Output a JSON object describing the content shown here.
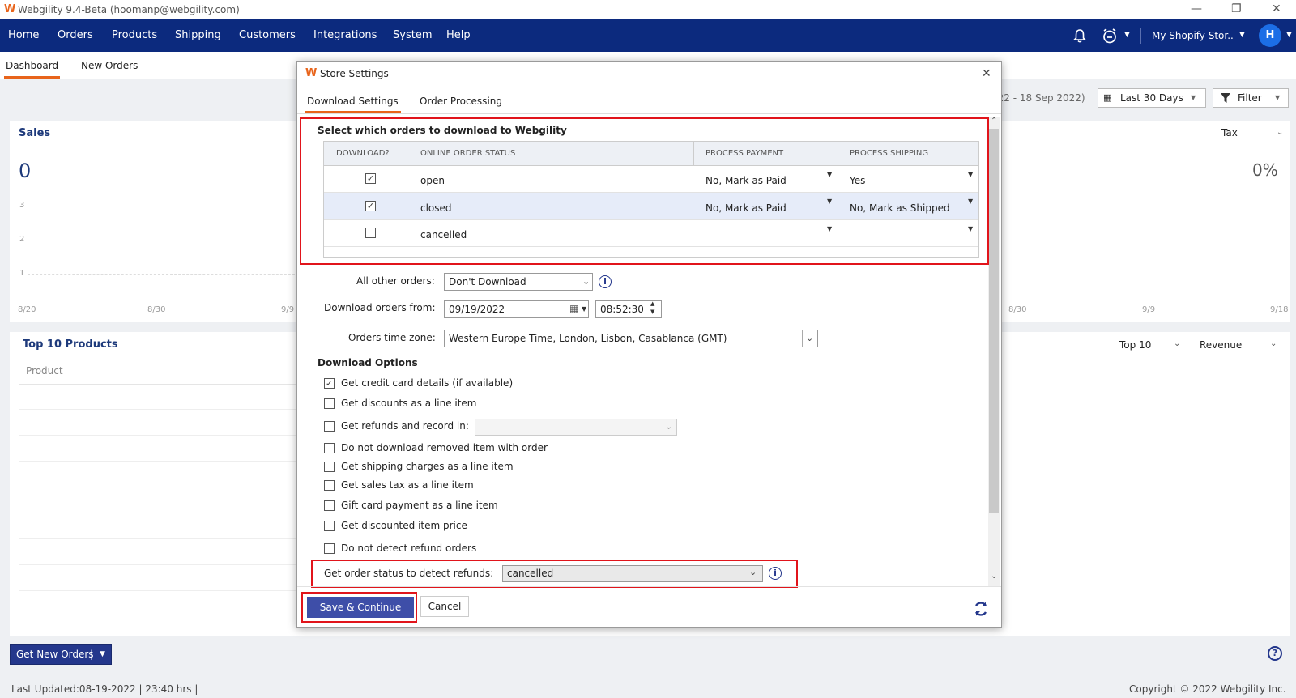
{
  "app": {
    "logo": "W",
    "title": "Webgility 9.4-Beta (hoomanp@webgility.com)",
    "minimize": "—",
    "restore": "❐",
    "close": "✕"
  },
  "nav": {
    "items": [
      "Home",
      "Orders",
      "Products",
      "Shipping",
      "Customers",
      "Integrations",
      "System",
      "Help"
    ],
    "store": "My Shopify Stor..",
    "avatar": "H"
  },
  "subtabs": [
    "Dashboard",
    "New Orders"
  ],
  "dashboard": {
    "sales_title": "Sales",
    "sales_value": "0",
    "y_ticks": [
      "3",
      "2",
      "1"
    ],
    "x_ticks": [
      "8/20",
      "8/30",
      "9/9"
    ],
    "date_range": "022 - 18 Sep 2022)",
    "range_select": "Last 30 Days",
    "filter": "Filter",
    "tax_label": "Tax",
    "tax_value": "0%",
    "right_x_ticks": [
      "8/30",
      "9/9",
      "9/18"
    ],
    "top_products_title": "Top 10 Products",
    "product_col": "Product",
    "top_select": "Top 10",
    "revenue_select": "Revenue",
    "get_new_orders": "Get New Orders",
    "last_updated": "Last Updated:08-19-2022 | 23:40 hrs |",
    "copyright": "Copyright © 2022 Webgility Inc."
  },
  "modal": {
    "logo": "W",
    "title": "Store Settings",
    "close": "✕",
    "tabs": [
      "Download Settings",
      "Order Processing"
    ],
    "section_title": "Select which orders to download to Webgility",
    "table": {
      "headers": [
        "DOWNLOAD?",
        "ONLINE ORDER STATUS",
        "PROCESS PAYMENT",
        "PROCESS SHIPPING"
      ],
      "rows": [
        {
          "checked": "✓",
          "status": "open",
          "payment": "No, Mark as Paid",
          "shipping": "Yes"
        },
        {
          "checked": "✓",
          "status": "closed",
          "payment": "No, Mark as Paid",
          "shipping": "No, Mark as Shipped"
        },
        {
          "checked": "",
          "status": "cancelled",
          "payment": "",
          "shipping": ""
        }
      ]
    },
    "all_other_label": "All other orders:",
    "all_other_value": "Don't Download",
    "download_from_label": "Download orders from:",
    "download_date": "09/19/2022",
    "download_time": "08:52:30",
    "timezone_label": "Orders time zone:",
    "timezone_value": "Western Europe Time, London, Lisbon, Casablanca (GMT)",
    "options_title": "Download Options",
    "options": [
      {
        "label": "Get credit card details (if available)",
        "checked": "✓"
      },
      {
        "label": "Get discounts as a line item",
        "checked": ""
      },
      {
        "label": "Get refunds and record in:",
        "checked": ""
      },
      {
        "label": "Do not download removed item with order",
        "checked": ""
      },
      {
        "label": "Get shipping charges as a line item",
        "checked": ""
      },
      {
        "label": "Get sales tax as a line item",
        "checked": ""
      },
      {
        "label": "Gift card payment as a line item",
        "checked": ""
      },
      {
        "label": "Get discounted item price",
        "checked": ""
      },
      {
        "label": "Do not detect refund orders",
        "checked": ""
      }
    ],
    "refund_status_label": "Get order status to detect refunds:",
    "refund_status_value": "cancelled",
    "save_button": "Save & Continue",
    "cancel_button": "Cancel"
  }
}
